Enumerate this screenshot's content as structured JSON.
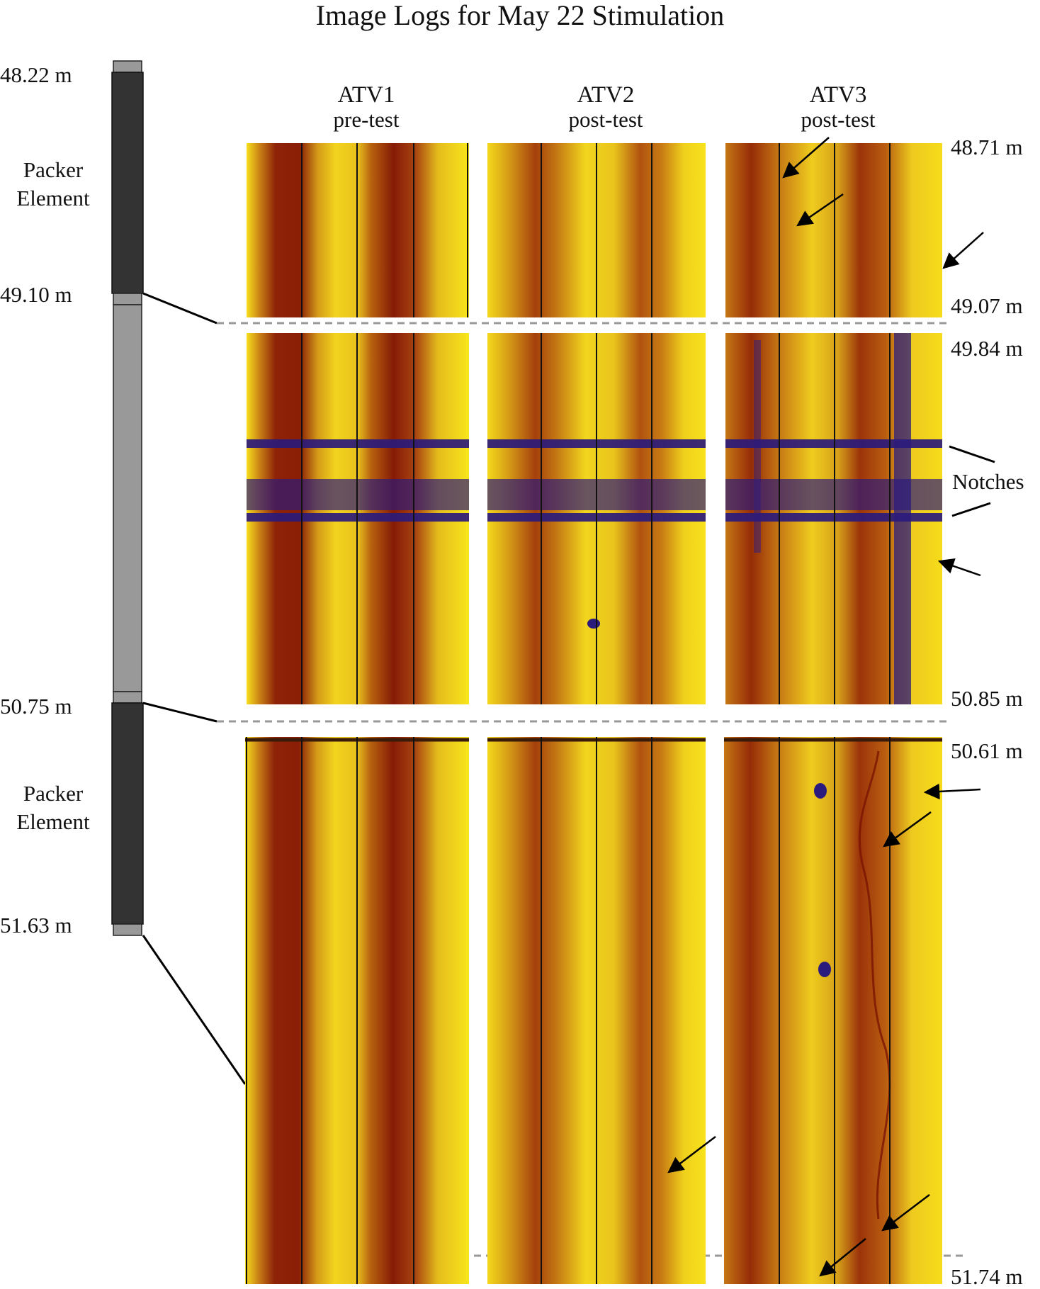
{
  "title": "Image Logs for May 22 Stimulation",
  "packer_depths": {
    "top": "48.22 m",
    "interval_top": "49.10 m",
    "interval_bottom": "50.75 m",
    "bottom": "51.63 m"
  },
  "packer_labels": {
    "upper": [
      "Packer",
      "Element"
    ],
    "lower": [
      "Packer",
      "Element"
    ]
  },
  "columns": [
    {
      "name": "ATV1",
      "state": "pre-test"
    },
    {
      "name": "ATV2",
      "state": "post-test"
    },
    {
      "name": "ATV3",
      "state": "post-test"
    }
  ],
  "log_depths": {
    "upper_top": "48.71 m",
    "upper_bottom": "49.07 m",
    "middle_top": "49.84 m",
    "middle_bottom": "50.85 m",
    "lower_top": "50.61 m",
    "lower_bottom": "51.74 m"
  },
  "notches_label": "Notches",
  "colors": {
    "bright": "#f7e31a",
    "mid": "#d9a11a",
    "dark": "#8b1c06",
    "notch": "#2a1a7a",
    "packer_dark": "#333333",
    "packer_light": "#999999",
    "dashed": "#999999"
  }
}
